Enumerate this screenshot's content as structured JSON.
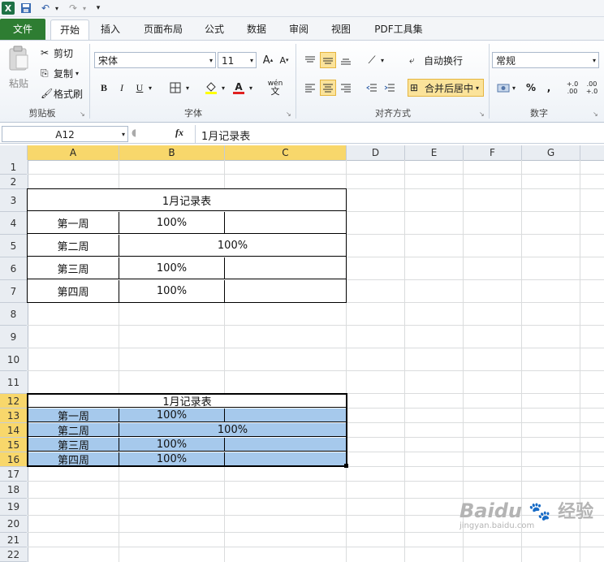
{
  "quick_access": {
    "undo_icon": "undo-icon",
    "redo_icon": "redo-icon"
  },
  "tabs": [
    "文件",
    "开始",
    "插入",
    "页面布局",
    "公式",
    "数据",
    "审阅",
    "视图",
    "PDF工具集"
  ],
  "ribbon": {
    "clipboard": {
      "paste": "粘贴",
      "cut": "剪切",
      "copy": "复制",
      "format_painter": "格式刷",
      "label": "剪贴板"
    },
    "font": {
      "name": "宋体",
      "size": "11",
      "label": "字体",
      "bold": "B",
      "italic": "I",
      "underline": "U",
      "phonetic": "wén"
    },
    "alignment": {
      "wrap": "自动换行",
      "merge": "合并后居中",
      "label": "对齐方式"
    },
    "number": {
      "format": "常规",
      "label": "数字",
      "percent": "%",
      "comma": ",",
      "inc_decimal": "+.0\n.00",
      "dec_decimal": ".00\n+.0"
    }
  },
  "formula_bar": {
    "name_box": "A12",
    "fx": "fx",
    "content": "1月记录表"
  },
  "columns": [
    "A",
    "B",
    "C",
    "D",
    "E",
    "F",
    "G"
  ],
  "rows": [
    "1",
    "2",
    "3",
    "4",
    "5",
    "6",
    "7",
    "8",
    "9",
    "10",
    "11",
    "12",
    "13",
    "14",
    "15",
    "16",
    "17",
    "18",
    "19",
    "20",
    "21",
    "22"
  ],
  "table1": {
    "title": "1月记录表",
    "rows": [
      {
        "label": "第一周",
        "value": "100%"
      },
      {
        "label": "第二周",
        "value": "100%"
      },
      {
        "label": "第三周",
        "value": "100%"
      },
      {
        "label": "第四周",
        "value": "100%"
      }
    ]
  },
  "table2": {
    "title": "1月记录表",
    "rows": [
      {
        "label": "第一周",
        "value": "100%"
      },
      {
        "label": "第二周",
        "value": "100%"
      },
      {
        "label": "第三周",
        "value": "100%"
      },
      {
        "label": "第四周",
        "value": "100%"
      }
    ]
  },
  "watermark": {
    "brand": "Baidu",
    "sub": "经验",
    "url": "jingyan.baidu.com"
  },
  "colors": {
    "file_tab": "#2e7d32",
    "selection": "#a6c9ec",
    "header_highlight": "#f8d76b"
  }
}
